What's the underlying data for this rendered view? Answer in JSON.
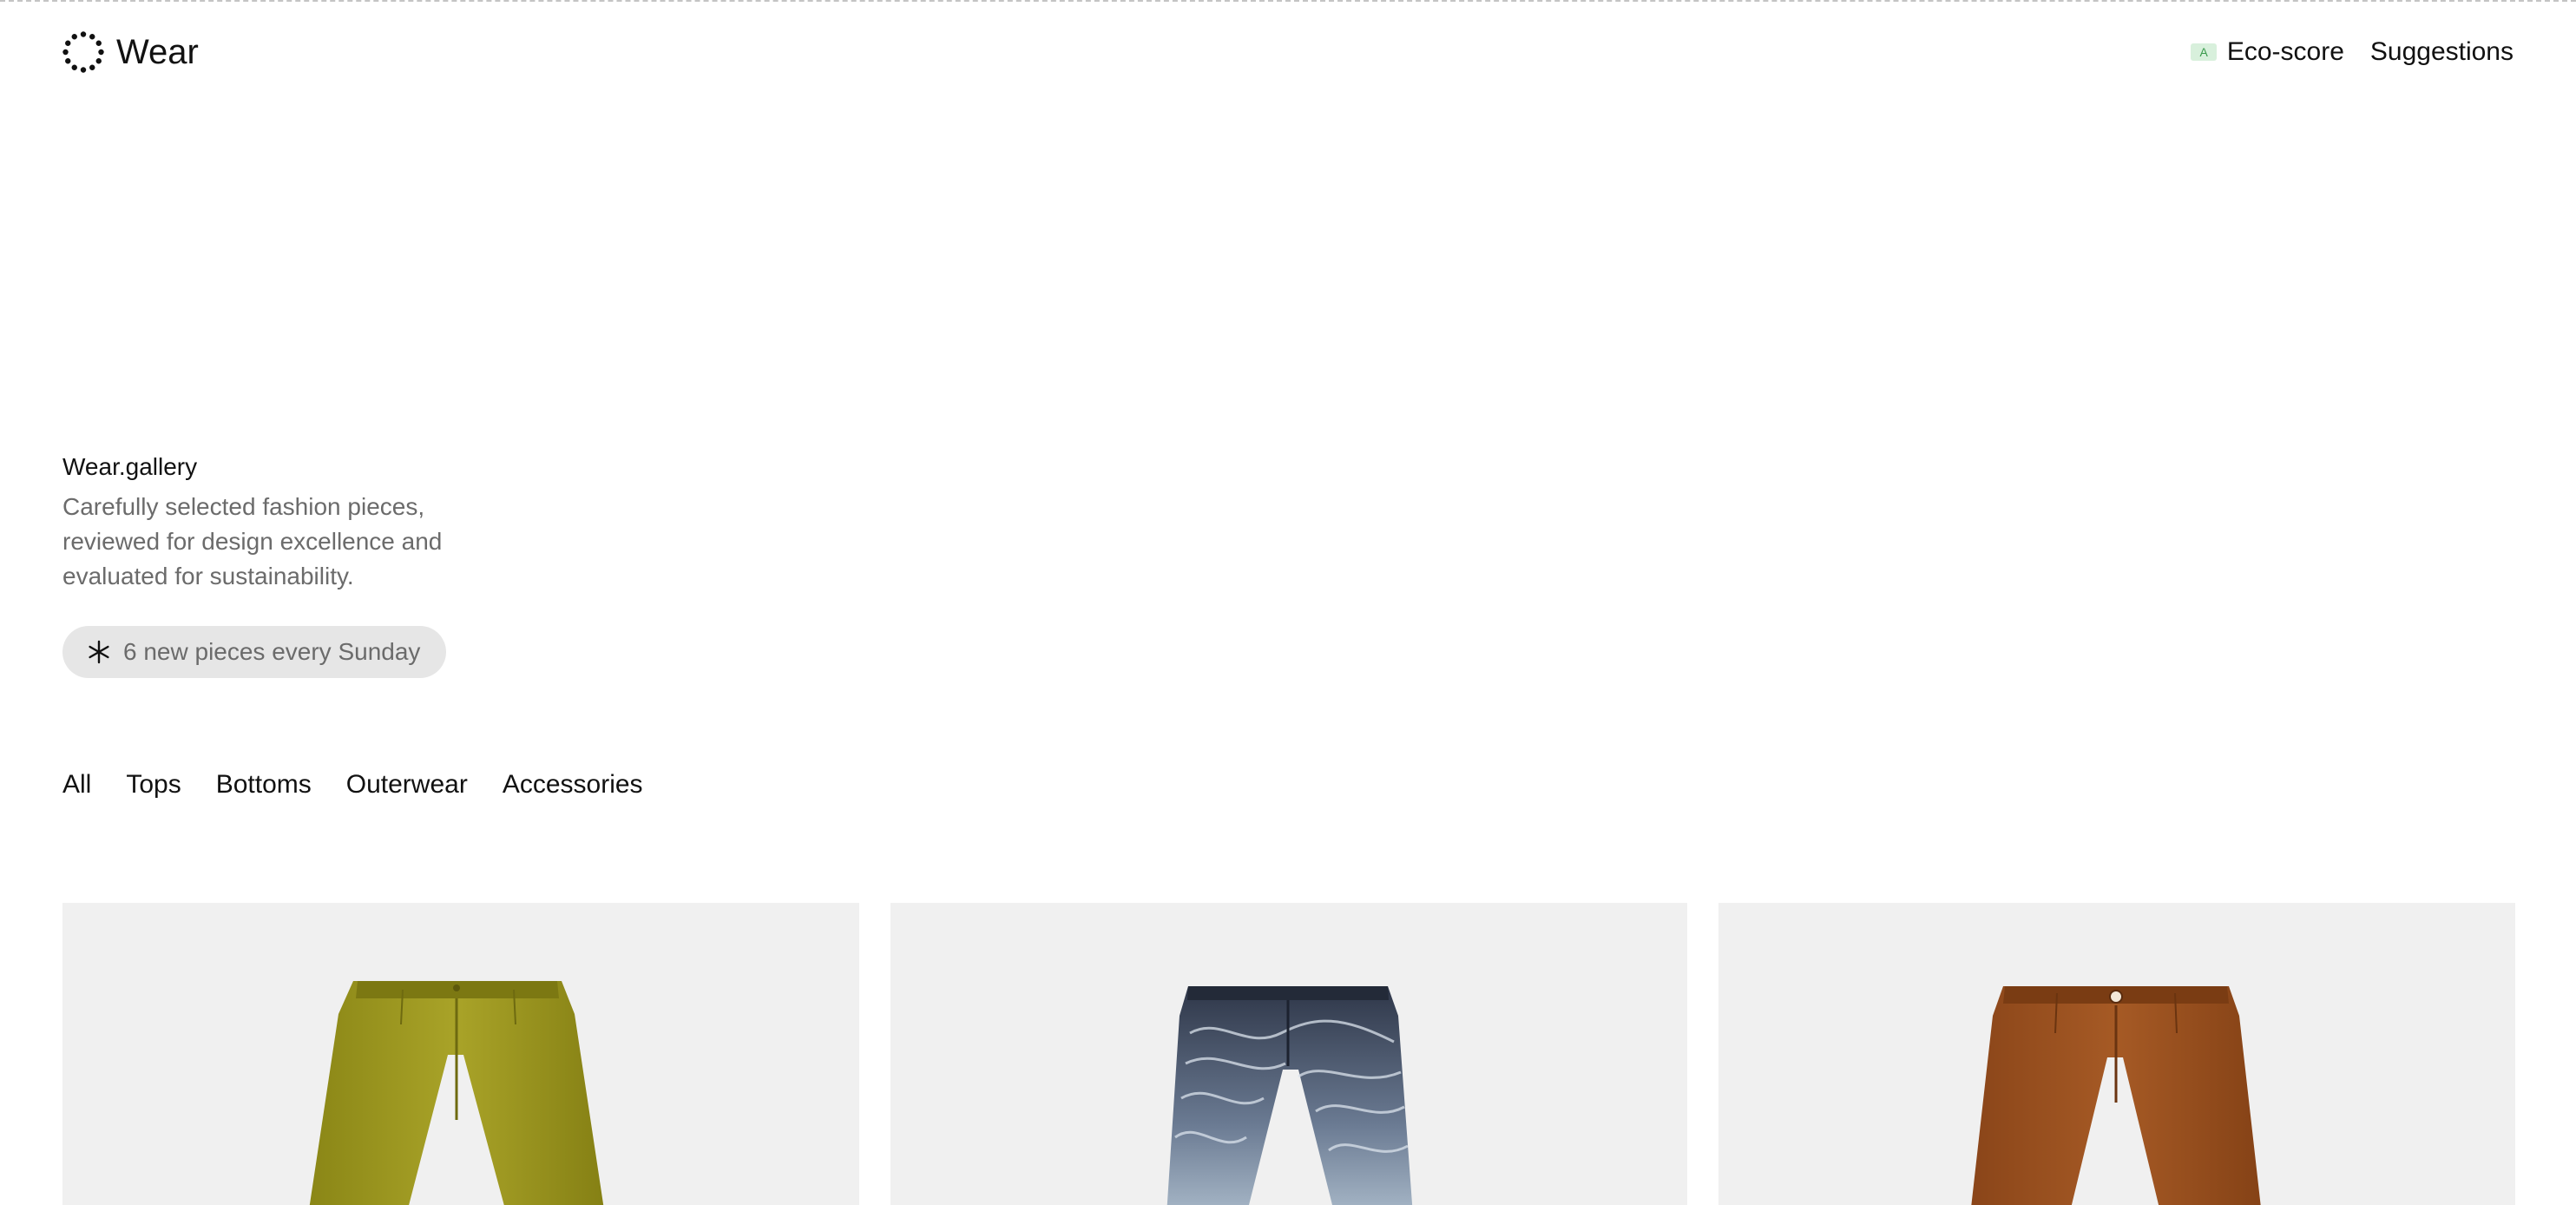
{
  "header": {
    "brand_name": "Wear",
    "nav": {
      "eco_badge": "A",
      "eco_label": "Eco-score",
      "suggestions_label": "Suggestions"
    }
  },
  "intro": {
    "title": "Wear.gallery",
    "description_lines": [
      "Carefully selected fashion pieces,",
      "reviewed for design excellence and",
      "evaluated for sustainability."
    ],
    "pill_text": "6 new pieces every Sunday",
    "pill_icon": "asterisk-icon"
  },
  "tabs": [
    {
      "label": "All"
    },
    {
      "label": "Tops"
    },
    {
      "label": "Bottoms"
    },
    {
      "label": "Outerwear"
    },
    {
      "label": "Accessories"
    }
  ],
  "products": [
    {
      "image": "olive-green-cord-trousers",
      "color": "#9e9a22"
    },
    {
      "image": "swirl-print-denim-jeans",
      "color": "#3e4a5e"
    },
    {
      "image": "brown-suede-trousers",
      "color": "#9a4f1f"
    }
  ],
  "colors": {
    "eco_badge_bg": "#d8f0dc",
    "eco_badge_text": "#3a9a4c",
    "card_bg": "#f0f0f0",
    "muted_text": "#6b6b6b",
    "pill_bg": "#e6e6e6"
  }
}
